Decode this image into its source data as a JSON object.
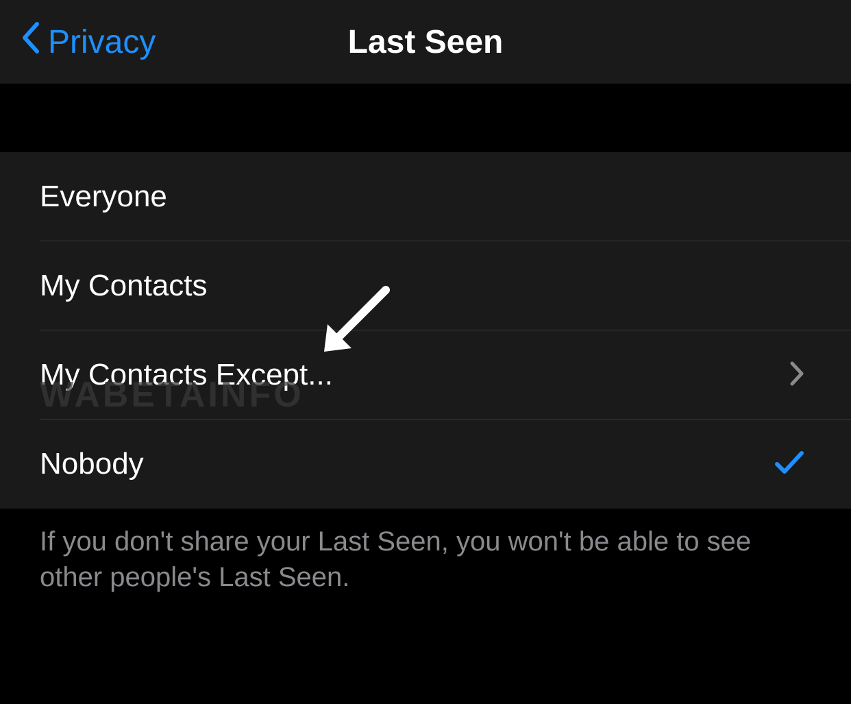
{
  "nav": {
    "back_label": "Privacy",
    "title": "Last Seen"
  },
  "options": [
    {
      "label": "Everyone",
      "has_disclosure": false,
      "selected": false
    },
    {
      "label": "My Contacts",
      "has_disclosure": false,
      "selected": false
    },
    {
      "label": "My Contacts Except...",
      "has_disclosure": true,
      "selected": false
    },
    {
      "label": "Nobody",
      "has_disclosure": false,
      "selected": true
    }
  ],
  "footer": {
    "text": "If you don't share your Last Seen, you won't be able to see other people's Last Seen."
  },
  "watermark": "WABETAINFO"
}
